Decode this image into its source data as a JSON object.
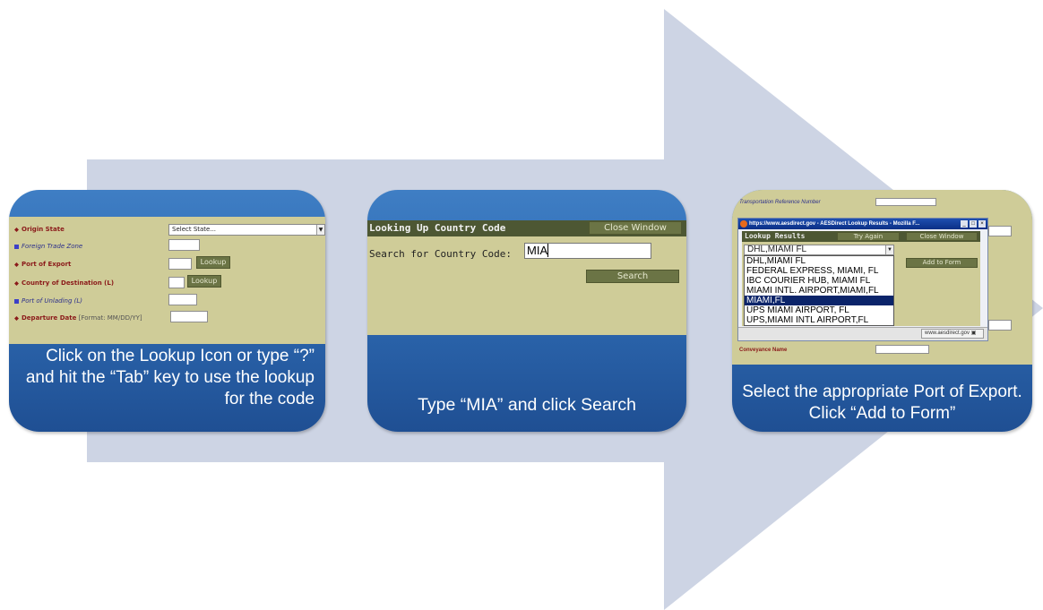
{
  "colors": {
    "arrow": "#cdd4e4",
    "card_top": "#3f7ec4",
    "card_bottom": "#1f4f93",
    "form_bg": "#cfcc98",
    "dark_header": "#4d5733"
  },
  "card1": {
    "fields": [
      {
        "label": "Origin State",
        "style": "required"
      },
      {
        "label": "Foreign Trade Zone",
        "style": "optional"
      },
      {
        "label": "Port of Export",
        "style": "required"
      },
      {
        "label": "Country of Destination (L)",
        "style": "required"
      },
      {
        "label": "Port of Unlading (L)",
        "style": "optional"
      },
      {
        "label": "Departure Date",
        "style": "required",
        "note": "[Format: MM/DD/YY]"
      }
    ],
    "select_value": "Select State...",
    "lookup_label": "Lookup",
    "caption": "Click on the Lookup Icon or type “?” and hit the “Tab” key to use the lookup for the code"
  },
  "card2": {
    "title": "Looking Up Country Code",
    "close_label": "Close Window",
    "search_label": "Search for Country Code:",
    "search_value": "MIA",
    "search_button": "Search",
    "caption": "Type “MIA” and click Search"
  },
  "card3": {
    "bg_label": "Transportation Reference Number",
    "bg_label2": "Conveyance Name",
    "window_title": "https://www.aesdirect.gov - AESDirect Lookup Results - Mozilla F...",
    "results_title": "Lookup Results",
    "try_again": "Try Again",
    "close_label": "Close Window",
    "select_value": "DHL,MIAMI FL",
    "add_label": "Add to Form",
    "status_url": "www.aesdirect.gov",
    "options": [
      "DHL,MIAMI FL",
      "FEDERAL EXPRESS, MIAMI, FL",
      "IBC COURIER HUB, MIAMI FL",
      "MIAMI INTL. AIRPORT,MIAMI,FL",
      "MIAMI,FL",
      "UPS MIAMI AIRPORT, FL",
      "UPS,MIAMI INTL AIRPORT,FL"
    ],
    "selected_option": "MIAMI,FL",
    "caption": "Select the appropriate Port of Export. Click “Add to Form”"
  }
}
